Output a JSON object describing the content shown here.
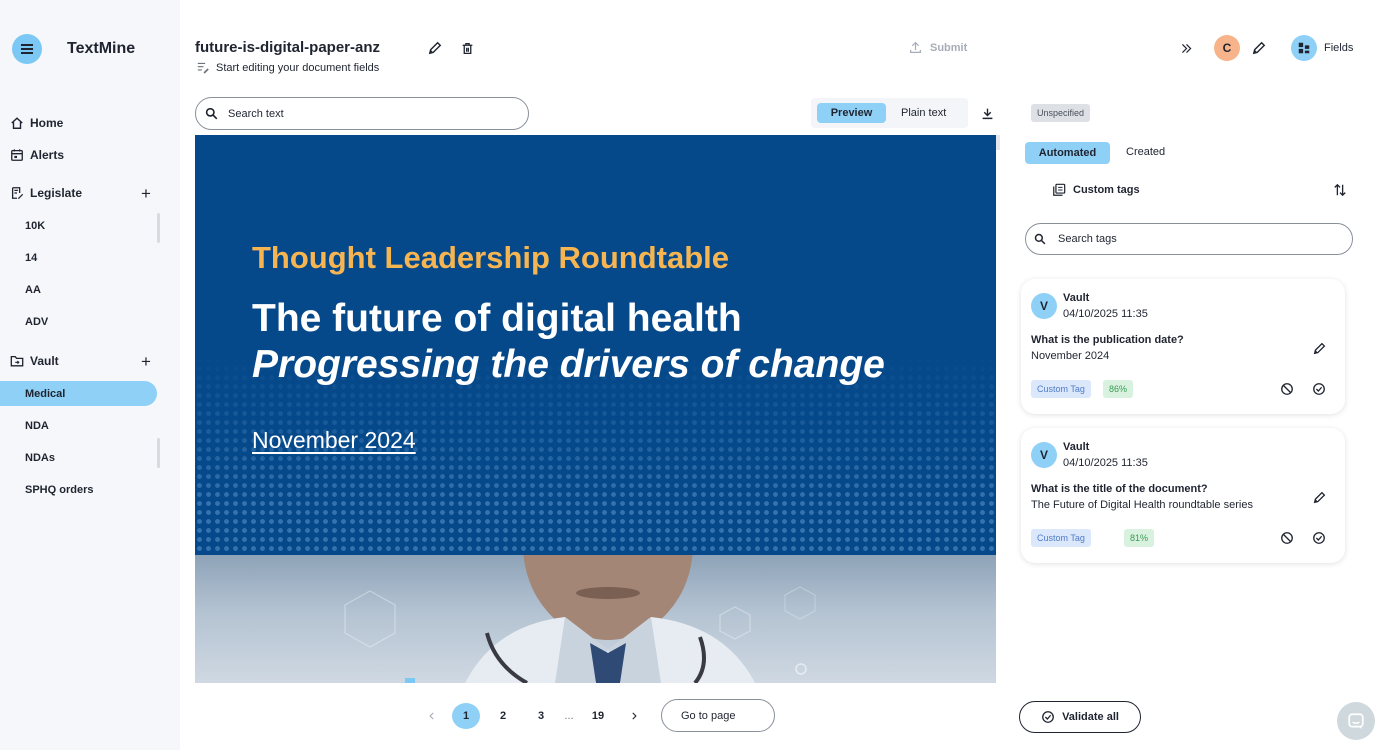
{
  "app": {
    "name": "TextMine"
  },
  "sidebar": {
    "home": "Home",
    "alerts": "Alerts",
    "legislate": {
      "label": "Legislate",
      "items": [
        "10K",
        "14",
        "AA",
        "ADV"
      ]
    },
    "vault": {
      "label": "Vault",
      "items": [
        "Medical",
        "NDA",
        "NDAs",
        "SPHQ orders"
      ],
      "active_index": 0
    }
  },
  "header": {
    "doc_title": "future-is-digital-paper-anz",
    "subtitle": "Start editing your document fields",
    "submit_label": "Submit",
    "user_initial": "C",
    "fields_label": "Fields"
  },
  "search": {
    "placeholder": "Search text"
  },
  "view_toggle": {
    "preview": "Preview",
    "plain": "Plain text",
    "active": "Preview"
  },
  "document": {
    "pre_title": "Thought Leadership Roundtable",
    "title": "The future of digital health",
    "subtitle": "Progressing the drivers of change",
    "date": "November 2024"
  },
  "pagination": {
    "pages": [
      "1",
      "2",
      "3",
      "...",
      "19"
    ],
    "current": "1",
    "goto_label": "Go to page"
  },
  "panel": {
    "status_badge": "Unspecified",
    "tabs": [
      "Automated",
      "Created"
    ],
    "active_tab": "Automated",
    "custom_tags_label": "Custom tags",
    "tag_search_placeholder": "Search tags",
    "cards": [
      {
        "initial": "V",
        "user": "Vault",
        "time": "04/10/2025 11:35",
        "question": "What is the publication date?",
        "answer": "November 2024",
        "tag": "Custom Tag",
        "score": "86%"
      },
      {
        "initial": "V",
        "user": "Vault",
        "time": "04/10/2025 11:35",
        "question": "What is the title of the document?",
        "answer": "The Future of Digital Health roundtable series",
        "tag": "Custom Tag",
        "score": "81%"
      }
    ],
    "validate_label": "Validate all"
  },
  "colors": {
    "accent": "#8fd0f7",
    "doc_blue": "#06498a",
    "doc_orange": "#f7b552",
    "avatar_orange": "#f7b48a"
  }
}
